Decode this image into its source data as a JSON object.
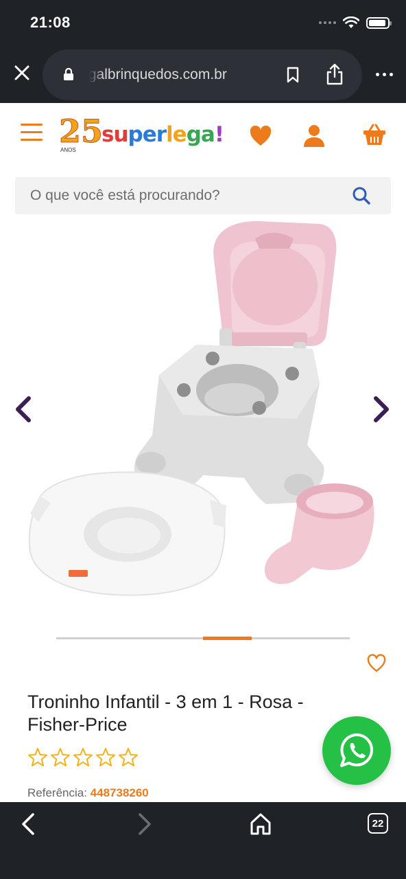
{
  "status": {
    "time": "21:08"
  },
  "browser": {
    "url": "superlegalbrinquedos.com.br",
    "tab_count": "22"
  },
  "site": {
    "logo_number": "25",
    "logo_anos": "ANOS",
    "logo_text": [
      "su",
      "per",
      "le",
      "ga",
      "!"
    ],
    "brand_color": "#ee7b1b"
  },
  "search": {
    "placeholder": "O que você está procurando?"
  },
  "gallery": {
    "slide_index": 3,
    "slide_count": 6
  },
  "product": {
    "title": "Troninho Infantil - 3 em 1 - Rosa - Fisher-Price",
    "rating": 0,
    "rating_max": 5,
    "reference_label": "Referência:",
    "reference_value": "448738260"
  },
  "icons": {
    "menu": "hamburger-icon",
    "favorites": "heart-icon",
    "account": "user-icon",
    "cart": "basket-icon",
    "search": "search-icon",
    "whatsapp": "whatsapp-icon"
  }
}
